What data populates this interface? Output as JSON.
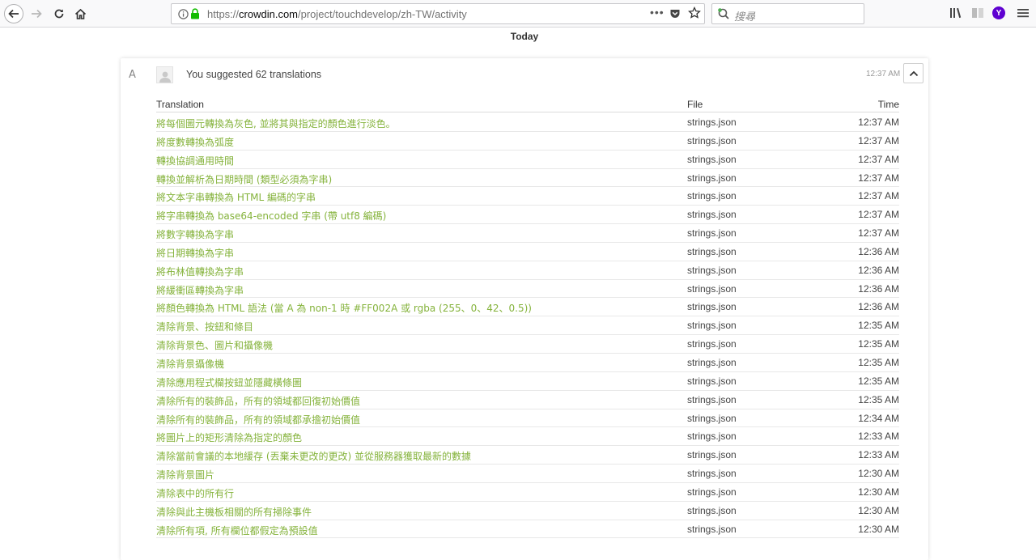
{
  "browser": {
    "url_scheme": "https://",
    "url_host": "crowdin.com",
    "url_path": "/project/touchdevelop/zh-TW/activity",
    "more_label": "•••",
    "search_placeholder": "搜尋",
    "profile_letter": "Y"
  },
  "page": {
    "day_label": "Today"
  },
  "activity": {
    "summary": "You suggested 62 translations",
    "time": "12:37 AM",
    "translate_icon_text": "A⁲"
  },
  "table": {
    "headers": {
      "translation": "Translation",
      "file": "File",
      "time": "Time"
    },
    "rows": [
      {
        "translation": "將每個圖元轉換為灰色, 並將其與指定的顏色進行淡色。",
        "file": "strings.json",
        "time": "12:37 AM"
      },
      {
        "translation": "將度數轉換為弧度",
        "file": "strings.json",
        "time": "12:37 AM"
      },
      {
        "translation": "轉換協調通用時間",
        "file": "strings.json",
        "time": "12:37 AM"
      },
      {
        "translation": "轉換並解析為日期時間 (類型必須為字串)",
        "file": "strings.json",
        "time": "12:37 AM"
      },
      {
        "translation": "將文本字串轉換為 HTML 編碼的字串",
        "file": "strings.json",
        "time": "12:37 AM"
      },
      {
        "translation": "將字串轉換為 base64-encoded 字串 (帶 utf8 編碼)",
        "file": "strings.json",
        "time": "12:37 AM"
      },
      {
        "translation": "將數字轉換為字串",
        "file": "strings.json",
        "time": "12:37 AM"
      },
      {
        "translation": "將日期轉換為字串",
        "file": "strings.json",
        "time": "12:36 AM"
      },
      {
        "translation": "將布林值轉換為字串",
        "file": "strings.json",
        "time": "12:36 AM"
      },
      {
        "translation": "將緩衝區轉換為字串",
        "file": "strings.json",
        "time": "12:36 AM"
      },
      {
        "translation": "將顏色轉換為 HTML 語法 (當 A 為 non-1 時 #FF002A 或 rgba (255、0、42、0.5))",
        "file": "strings.json",
        "time": "12:36 AM"
      },
      {
        "translation": "清除背景、按鈕和條目",
        "file": "strings.json",
        "time": "12:35 AM"
      },
      {
        "translation": "清除背景色、圖片和攝像機",
        "file": "strings.json",
        "time": "12:35 AM"
      },
      {
        "translation": "清除背景攝像機",
        "file": "strings.json",
        "time": "12:35 AM"
      },
      {
        "translation": "清除應用程式欄按鈕並隱藏橫條圖",
        "file": "strings.json",
        "time": "12:35 AM"
      },
      {
        "translation": "清除所有的裝飾品，所有的領域都回復初始價值",
        "file": "strings.json",
        "time": "12:35 AM"
      },
      {
        "translation": "清除所有的裝飾品，所有的領域都承擔初始價值",
        "file": "strings.json",
        "time": "12:34 AM"
      },
      {
        "translation": "將圖片上的矩形清除為指定的顏色",
        "file": "strings.json",
        "time": "12:33 AM"
      },
      {
        "translation": "清除當前會議的本地緩存 (丟棄未更改的更改) 並從服務器獲取最新的數據",
        "file": "strings.json",
        "time": "12:33 AM"
      },
      {
        "translation": "清除背景圖片",
        "file": "strings.json",
        "time": "12:30 AM"
      },
      {
        "translation": "清除表中的所有行",
        "file": "strings.json",
        "time": "12:30 AM"
      },
      {
        "translation": "清除與此主機板相關的所有掃除事件",
        "file": "strings.json",
        "time": "12:30 AM"
      },
      {
        "translation": "清除所有項, 所有欄位都假定為預設值",
        "file": "strings.json",
        "time": "12:30 AM"
      }
    ]
  }
}
